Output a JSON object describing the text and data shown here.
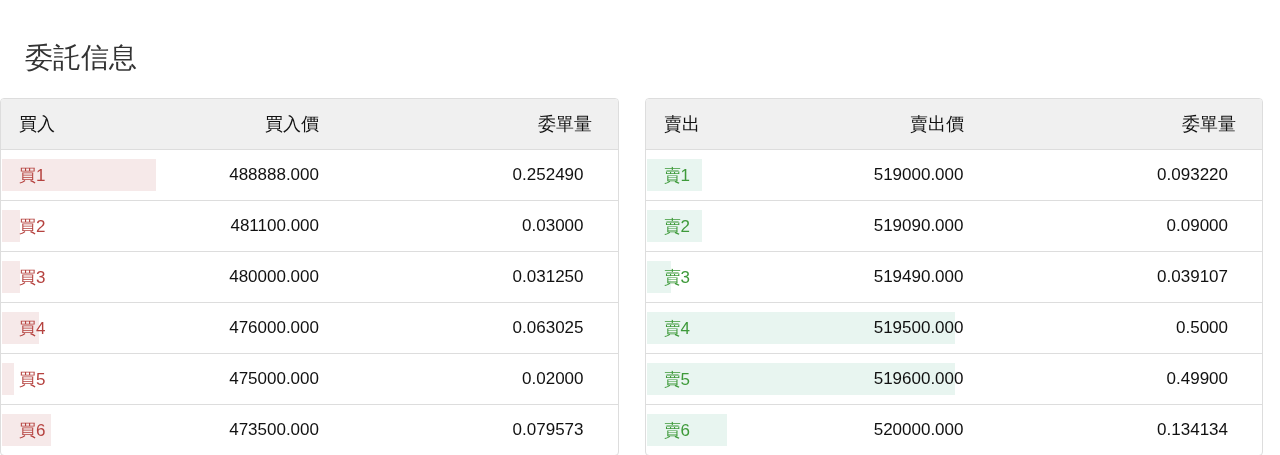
{
  "title": "委託信息",
  "books": [
    {
      "kind": "buy",
      "columns": [
        "買入",
        "買入價",
        "委單量"
      ],
      "rows": [
        {
          "label": "買1",
          "price": "488888.000",
          "amount": "0.252490",
          "level": 0.25
        },
        {
          "label": "買2",
          "price": "481100.000",
          "amount": "0.03000",
          "level": 0.03
        },
        {
          "label": "買3",
          "price": "480000.000",
          "amount": "0.031250",
          "level": 0.03
        },
        {
          "label": "買4",
          "price": "476000.000",
          "amount": "0.063025",
          "level": 0.06
        },
        {
          "label": "買5",
          "price": "475000.000",
          "amount": "0.02000",
          "level": 0.02
        },
        {
          "label": "買6",
          "price": "473500.000",
          "amount": "0.079573",
          "level": 0.08
        }
      ]
    },
    {
      "kind": "sell",
      "columns": [
        "賣出",
        "賣出價",
        "委單量"
      ],
      "rows": [
        {
          "label": "賣1",
          "price": "519000.000",
          "amount": "0.093220",
          "level": 0.09
        },
        {
          "label": "賣2",
          "price": "519090.000",
          "amount": "0.09000",
          "level": 0.09
        },
        {
          "label": "賣3",
          "price": "519490.000",
          "amount": "0.039107",
          "level": 0.04
        },
        {
          "label": "賣4",
          "price": "519500.000",
          "amount": "0.5000",
          "level": 0.5
        },
        {
          "label": "賣5",
          "price": "519600.000",
          "amount": "0.49900",
          "level": 0.5
        },
        {
          "label": "賣6",
          "price": "520000.000",
          "amount": "0.134134",
          "level": 0.13
        }
      ]
    }
  ]
}
